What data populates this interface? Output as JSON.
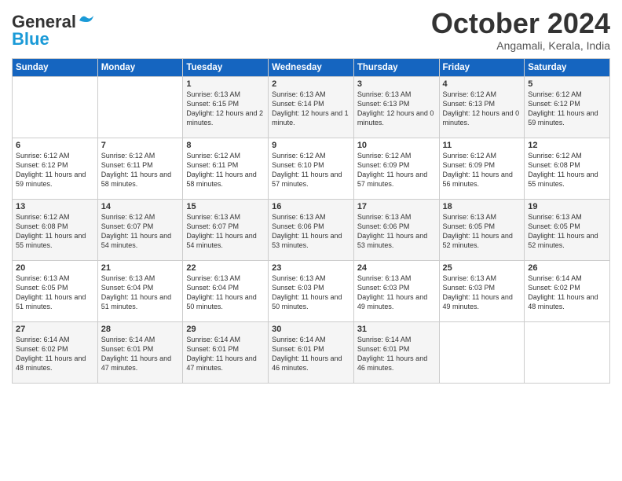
{
  "logo": {
    "line1": "General",
    "line2": "Blue"
  },
  "title": "October 2024",
  "location": "Angamali, Kerala, India",
  "header_days": [
    "Sunday",
    "Monday",
    "Tuesday",
    "Wednesday",
    "Thursday",
    "Friday",
    "Saturday"
  ],
  "weeks": [
    [
      {
        "day": "",
        "sunrise": "",
        "sunset": "",
        "daylight": ""
      },
      {
        "day": "",
        "sunrise": "",
        "sunset": "",
        "daylight": ""
      },
      {
        "day": "1",
        "sunrise": "Sunrise: 6:13 AM",
        "sunset": "Sunset: 6:15 PM",
        "daylight": "Daylight: 12 hours and 2 minutes."
      },
      {
        "day": "2",
        "sunrise": "Sunrise: 6:13 AM",
        "sunset": "Sunset: 6:14 PM",
        "daylight": "Daylight: 12 hours and 1 minute."
      },
      {
        "day": "3",
        "sunrise": "Sunrise: 6:13 AM",
        "sunset": "Sunset: 6:13 PM",
        "daylight": "Daylight: 12 hours and 0 minutes."
      },
      {
        "day": "4",
        "sunrise": "Sunrise: 6:12 AM",
        "sunset": "Sunset: 6:13 PM",
        "daylight": "Daylight: 12 hours and 0 minutes."
      },
      {
        "day": "5",
        "sunrise": "Sunrise: 6:12 AM",
        "sunset": "Sunset: 6:12 PM",
        "daylight": "Daylight: 11 hours and 59 minutes."
      }
    ],
    [
      {
        "day": "6",
        "sunrise": "Sunrise: 6:12 AM",
        "sunset": "Sunset: 6:12 PM",
        "daylight": "Daylight: 11 hours and 59 minutes."
      },
      {
        "day": "7",
        "sunrise": "Sunrise: 6:12 AM",
        "sunset": "Sunset: 6:11 PM",
        "daylight": "Daylight: 11 hours and 58 minutes."
      },
      {
        "day": "8",
        "sunrise": "Sunrise: 6:12 AM",
        "sunset": "Sunset: 6:11 PM",
        "daylight": "Daylight: 11 hours and 58 minutes."
      },
      {
        "day": "9",
        "sunrise": "Sunrise: 6:12 AM",
        "sunset": "Sunset: 6:10 PM",
        "daylight": "Daylight: 11 hours and 57 minutes."
      },
      {
        "day": "10",
        "sunrise": "Sunrise: 6:12 AM",
        "sunset": "Sunset: 6:09 PM",
        "daylight": "Daylight: 11 hours and 57 minutes."
      },
      {
        "day": "11",
        "sunrise": "Sunrise: 6:12 AM",
        "sunset": "Sunset: 6:09 PM",
        "daylight": "Daylight: 11 hours and 56 minutes."
      },
      {
        "day": "12",
        "sunrise": "Sunrise: 6:12 AM",
        "sunset": "Sunset: 6:08 PM",
        "daylight": "Daylight: 11 hours and 55 minutes."
      }
    ],
    [
      {
        "day": "13",
        "sunrise": "Sunrise: 6:12 AM",
        "sunset": "Sunset: 6:08 PM",
        "daylight": "Daylight: 11 hours and 55 minutes."
      },
      {
        "day": "14",
        "sunrise": "Sunrise: 6:12 AM",
        "sunset": "Sunset: 6:07 PM",
        "daylight": "Daylight: 11 hours and 54 minutes."
      },
      {
        "day": "15",
        "sunrise": "Sunrise: 6:13 AM",
        "sunset": "Sunset: 6:07 PM",
        "daylight": "Daylight: 11 hours and 54 minutes."
      },
      {
        "day": "16",
        "sunrise": "Sunrise: 6:13 AM",
        "sunset": "Sunset: 6:06 PM",
        "daylight": "Daylight: 11 hours and 53 minutes."
      },
      {
        "day": "17",
        "sunrise": "Sunrise: 6:13 AM",
        "sunset": "Sunset: 6:06 PM",
        "daylight": "Daylight: 11 hours and 53 minutes."
      },
      {
        "day": "18",
        "sunrise": "Sunrise: 6:13 AM",
        "sunset": "Sunset: 6:05 PM",
        "daylight": "Daylight: 11 hours and 52 minutes."
      },
      {
        "day": "19",
        "sunrise": "Sunrise: 6:13 AM",
        "sunset": "Sunset: 6:05 PM",
        "daylight": "Daylight: 11 hours and 52 minutes."
      }
    ],
    [
      {
        "day": "20",
        "sunrise": "Sunrise: 6:13 AM",
        "sunset": "Sunset: 6:05 PM",
        "daylight": "Daylight: 11 hours and 51 minutes."
      },
      {
        "day": "21",
        "sunrise": "Sunrise: 6:13 AM",
        "sunset": "Sunset: 6:04 PM",
        "daylight": "Daylight: 11 hours and 51 minutes."
      },
      {
        "day": "22",
        "sunrise": "Sunrise: 6:13 AM",
        "sunset": "Sunset: 6:04 PM",
        "daylight": "Daylight: 11 hours and 50 minutes."
      },
      {
        "day": "23",
        "sunrise": "Sunrise: 6:13 AM",
        "sunset": "Sunset: 6:03 PM",
        "daylight": "Daylight: 11 hours and 50 minutes."
      },
      {
        "day": "24",
        "sunrise": "Sunrise: 6:13 AM",
        "sunset": "Sunset: 6:03 PM",
        "daylight": "Daylight: 11 hours and 49 minutes."
      },
      {
        "day": "25",
        "sunrise": "Sunrise: 6:13 AM",
        "sunset": "Sunset: 6:03 PM",
        "daylight": "Daylight: 11 hours and 49 minutes."
      },
      {
        "day": "26",
        "sunrise": "Sunrise: 6:14 AM",
        "sunset": "Sunset: 6:02 PM",
        "daylight": "Daylight: 11 hours and 48 minutes."
      }
    ],
    [
      {
        "day": "27",
        "sunrise": "Sunrise: 6:14 AM",
        "sunset": "Sunset: 6:02 PM",
        "daylight": "Daylight: 11 hours and 48 minutes."
      },
      {
        "day": "28",
        "sunrise": "Sunrise: 6:14 AM",
        "sunset": "Sunset: 6:01 PM",
        "daylight": "Daylight: 11 hours and 47 minutes."
      },
      {
        "day": "29",
        "sunrise": "Sunrise: 6:14 AM",
        "sunset": "Sunset: 6:01 PM",
        "daylight": "Daylight: 11 hours and 47 minutes."
      },
      {
        "day": "30",
        "sunrise": "Sunrise: 6:14 AM",
        "sunset": "Sunset: 6:01 PM",
        "daylight": "Daylight: 11 hours and 46 minutes."
      },
      {
        "day": "31",
        "sunrise": "Sunrise: 6:14 AM",
        "sunset": "Sunset: 6:01 PM",
        "daylight": "Daylight: 11 hours and 46 minutes."
      },
      {
        "day": "",
        "sunrise": "",
        "sunset": "",
        "daylight": ""
      },
      {
        "day": "",
        "sunrise": "",
        "sunset": "",
        "daylight": ""
      }
    ]
  ]
}
